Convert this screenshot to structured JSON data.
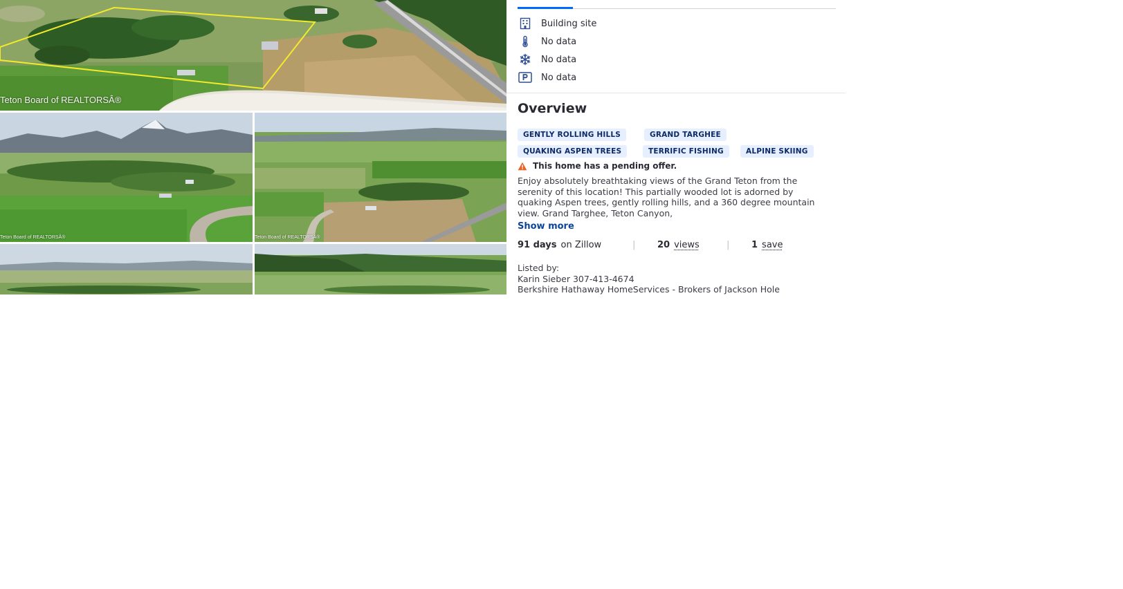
{
  "gallery": {
    "main_watermark": "Teton Board of REALTORSÂ®",
    "thumb_watermark": "Teton Board of REALTORSÂ®"
  },
  "facts": [
    {
      "icon": "building-icon",
      "label": "Building site"
    },
    {
      "icon": "thermometer-icon",
      "label": "No data"
    },
    {
      "icon": "snowflake-icon",
      "label": "No data"
    },
    {
      "icon": "parking-icon",
      "label": "No data"
    }
  ],
  "overview": {
    "title": "Overview",
    "tags": [
      "GENTLY ROLLING HILLS",
      "GRAND TARGHEE",
      "QUAKING ASPEN TREES",
      "TERRIFIC FISHING",
      "ALPINE SKIING"
    ],
    "pending_notice": "This home has a pending offer.",
    "description": "Enjoy absolutely breathtaking views of the Grand Teton from the serenity of this location!  This partially wooded lot is adorned by quaking Aspen trees, gently rolling hills, and a 360 degree mountain view.  Grand Targhee, Teton Canyon,",
    "show_more_label": "Show more"
  },
  "stats": {
    "days_value": "91 days",
    "days_label": "on Zillow",
    "views_value": "20",
    "views_label": "views",
    "saves_value": "1",
    "saves_label": "save"
  },
  "listing": {
    "listed_by_label": "Listed by:",
    "agent": "Karin Sieber 307-413-4674",
    "brokerage": "Berkshire Hathaway HomeServices - Brokers of Jackson Hole"
  },
  "colors": {
    "accent": "#006aff",
    "tag_bg": "#e6efff",
    "tag_text": "#0d2a66",
    "link": "#0d4599",
    "warning": "#e8632a",
    "icon": "#2f4f8f"
  }
}
